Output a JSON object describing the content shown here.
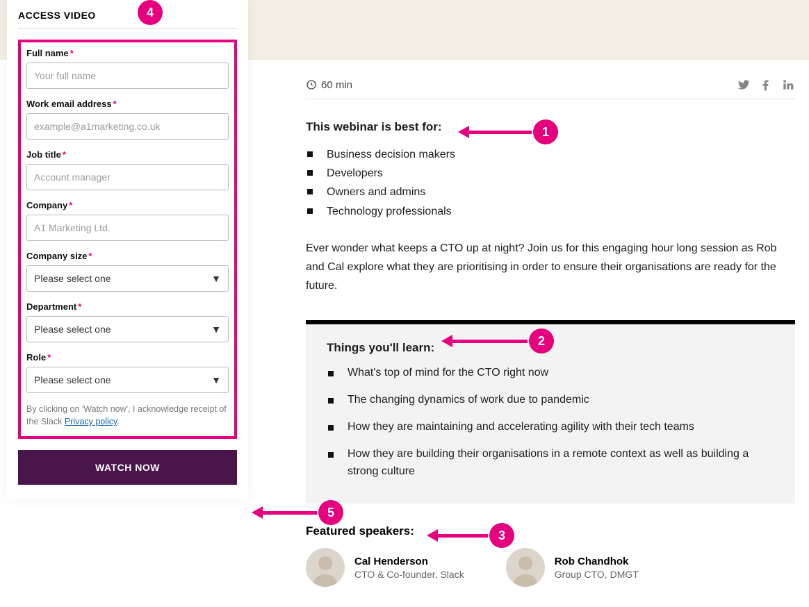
{
  "form": {
    "title": "ACCESS VIDEO",
    "fullName": {
      "label": "Full name",
      "placeholder": "Your full name"
    },
    "email": {
      "label": "Work email address",
      "placeholder": "example@a1marketing.co.uk"
    },
    "jobTitle": {
      "label": "Job title",
      "placeholder": "Account manager"
    },
    "company": {
      "label": "Company",
      "placeholder": "A1 Marketing Ltd."
    },
    "companySize": {
      "label": "Company size",
      "value": "Please select one"
    },
    "department": {
      "label": "Department",
      "value": "Please select one"
    },
    "role": {
      "label": "Role",
      "value": "Please select one"
    },
    "disclaimer": {
      "pre": "By clicking on 'Watch now', I acknowledge receipt of the Slack ",
      "linkText": "Privacy policy",
      "post": "."
    },
    "submit": "WATCH NOW"
  },
  "meta": {
    "duration": "60 min"
  },
  "bestFor": {
    "heading": "This webinar is best for:",
    "items": [
      "Business decision makers",
      "Developers",
      "Owners and admins",
      "Technology professionals"
    ]
  },
  "intro": "Ever wonder what keeps a CTO up at night? Join us for this engaging hour long session as Rob and Cal explore what they are prioritising in order to ensure their organisations are ready for the future.",
  "learn": {
    "heading": "Things you'll learn:",
    "items": [
      "What's top of mind for the CTO right now",
      "The changing dynamics of work due to pandemic",
      "How they are maintaining and accelerating agility with their tech teams",
      "How they are building their organisations in a remote context as well as building a strong culture"
    ]
  },
  "speakers": {
    "heading": "Featured speakers:",
    "list": [
      {
        "name": "Cal Henderson",
        "title": "CTO & Co-founder, Slack"
      },
      {
        "name": "Rob Chandhok",
        "title": "Group CTO, DMGT"
      }
    ]
  },
  "callouts": {
    "c1": "1",
    "c2": "2",
    "c3": "3",
    "c4": "4",
    "c5": "5"
  }
}
